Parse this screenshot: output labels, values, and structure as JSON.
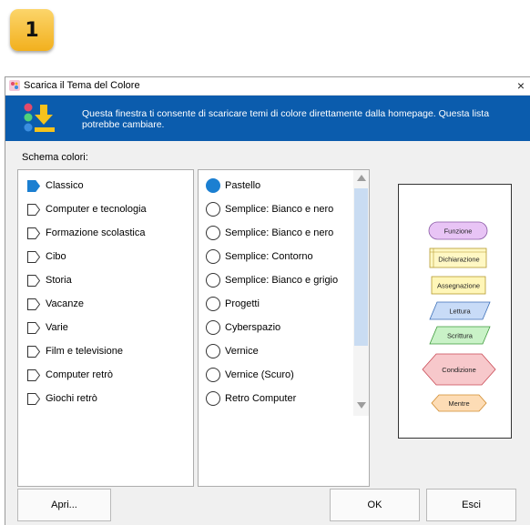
{
  "badge": {
    "number": "1"
  },
  "window": {
    "title": "Scarica il Tema del Colore",
    "close_glyph": "×"
  },
  "banner": {
    "message": "Questa finestra ti consente di scaricare temi di colore direttamente dalla homepage. Questa lista potrebbe cambiare."
  },
  "schema_label": "Schema colori:",
  "categories": [
    {
      "label": "Classico",
      "selected": true
    },
    {
      "label": "Computer e tecnologia",
      "selected": false
    },
    {
      "label": "Formazione scolastica",
      "selected": false
    },
    {
      "label": "Cibo",
      "selected": false
    },
    {
      "label": "Storia",
      "selected": false
    },
    {
      "label": "Vacanze",
      "selected": false
    },
    {
      "label": "Varie",
      "selected": false
    },
    {
      "label": "Film e televisione",
      "selected": false
    },
    {
      "label": "Computer retrò",
      "selected": false
    },
    {
      "label": "Giochi retrò",
      "selected": false
    }
  ],
  "themes": [
    {
      "label": "Pastello",
      "selected": true
    },
    {
      "label": "Semplice: Bianco e nero",
      "selected": false
    },
    {
      "label": "Semplice: Bianco e nero",
      "selected": false
    },
    {
      "label": "Semplice: Contorno",
      "selected": false
    },
    {
      "label": "Semplice: Bianco e grigio",
      "selected": false
    },
    {
      "label": "Progetti",
      "selected": false
    },
    {
      "label": "Cyberspazio",
      "selected": false
    },
    {
      "label": "Vernice",
      "selected": false
    },
    {
      "label": "Vernice (Scuro)",
      "selected": false
    },
    {
      "label": "Retro Computer",
      "selected": false
    }
  ],
  "preview": {
    "shapes": [
      {
        "label": "Funzione",
        "fill": "#e8c4f5"
      },
      {
        "label": "Dichiarazione",
        "fill": "#fff8c4"
      },
      {
        "label": "Assegnazione",
        "fill": "#fff6b8"
      },
      {
        "label": "Lettura",
        "fill": "#c8dbf7"
      },
      {
        "label": "Scrittura",
        "fill": "#c9f2c7"
      },
      {
        "label": "Condizione",
        "fill": "#f7c8cb"
      },
      {
        "label": "Mentre",
        "fill": "#fddcb5"
      }
    ]
  },
  "buttons": {
    "open": "Apri...",
    "ok": "OK",
    "exit": "Esci"
  },
  "colors": {
    "banner": "#0b5cad",
    "selected_accent": "#1b7fd1"
  }
}
